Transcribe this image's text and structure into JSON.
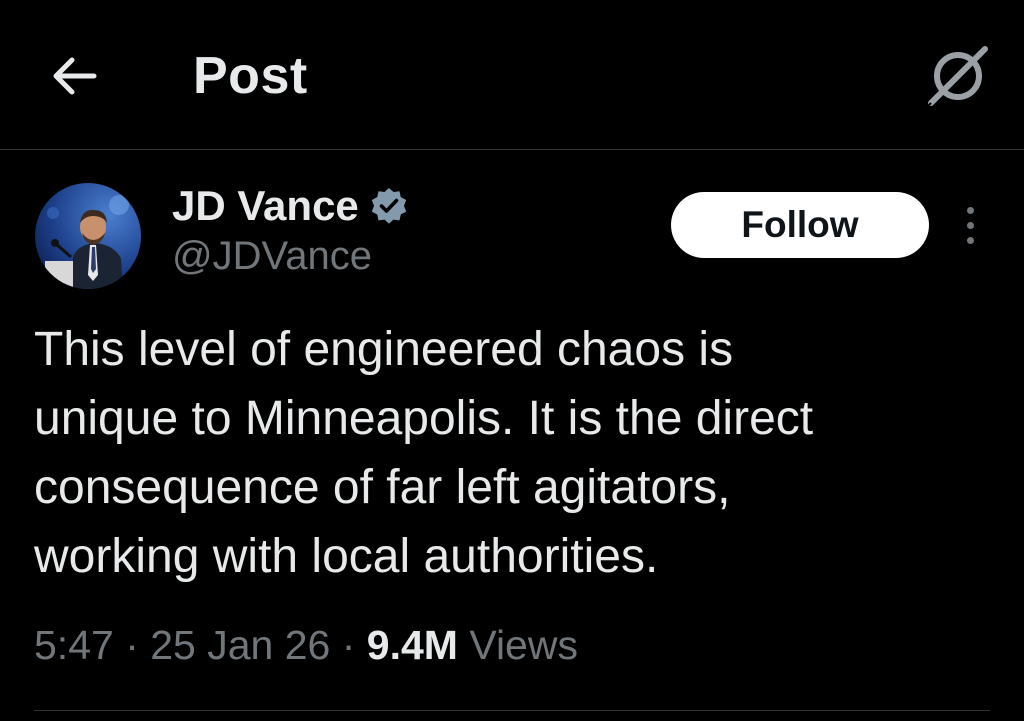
{
  "header": {
    "title": "Post",
    "back_icon": "arrow-left-icon",
    "grok_icon": "grok-icon"
  },
  "post": {
    "author": {
      "name": "JD Vance",
      "handle": "@JDVance",
      "verified": true,
      "avatar_icon": "avatar-photo"
    },
    "follow_label": "Follow",
    "more_icon": "more-vertical-icon",
    "text": "This level of engineered chaos is\nunique to Minneapolis. It is the direct\nconsequence of far left agitators,\nworking with local authorities.",
    "time": "5:47",
    "separator": " · ",
    "date": "25 Jan 26",
    "views_count": "9.4M",
    "views_label": " Views"
  },
  "colors": {
    "background": "#000000",
    "text_primary": "#e7e9ea",
    "text_secondary": "#71767b",
    "divider": "#2f3336",
    "verified_badge": "#829aab",
    "follow_bg": "#ffffff",
    "follow_text": "#0f1419"
  }
}
